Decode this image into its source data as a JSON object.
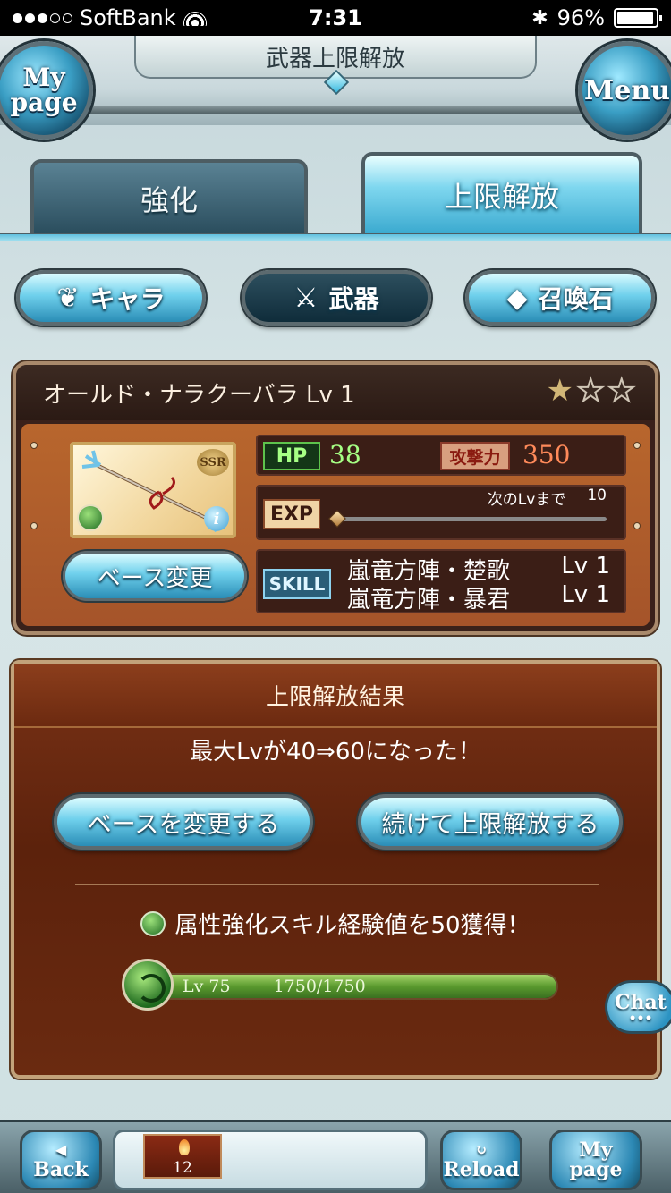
{
  "status_bar": {
    "carrier": "SoftBank",
    "time": "7:31",
    "battery": "96%",
    "battery_level": 0.96
  },
  "header": {
    "title": "武器上限解放",
    "mypage_line1": "My",
    "mypage_line2": "page",
    "menu": "Menu"
  },
  "tabs": [
    {
      "label": "強化",
      "active": false
    },
    {
      "label": "上限解放",
      "active": true
    }
  ],
  "categories": [
    {
      "label": "キャラ",
      "icon": "ornament-icon"
    },
    {
      "label": "武器",
      "icon": "crossed-swords-icon",
      "selected": true
    },
    {
      "label": "召喚石",
      "icon": "crystal-icon"
    }
  ],
  "weapon": {
    "name_line": "オールド・ナラクーバラ Lv 1",
    "stars_filled": 1,
    "stars_total": 3,
    "rarity": "SSR",
    "hp_label": "HP",
    "hp": "38",
    "atk_label": "攻撃力",
    "atk": "350",
    "exp_label": "EXP",
    "next_lv_label": "次のLvまで",
    "next_lv_value": "10",
    "exp_progress": 0.0,
    "skill_label": "SKILL",
    "skills": [
      {
        "name": "嵐竜方陣・楚歌",
        "level": "Lv 1"
      },
      {
        "name": "嵐竜方陣・暴君",
        "level": "Lv 1"
      }
    ],
    "change_base_label": "ベース変更"
  },
  "result": {
    "title": "上限解放結果",
    "message": "最大Lvが40⇒60になった！",
    "button_change_base": "ベースを変更する",
    "button_continue": "続けて上限解放する",
    "gain_message": "属性強化スキル経験値を50獲得！",
    "level_text": "Lv 75",
    "exp_text": "1750/1750",
    "exp_fraction": 1.0
  },
  "chat_label": "Chat",
  "bottom_bar": {
    "back": "Back",
    "reload": "Reload",
    "mypage_line1": "My",
    "mypage_line2": "page",
    "item_count": "12"
  }
}
